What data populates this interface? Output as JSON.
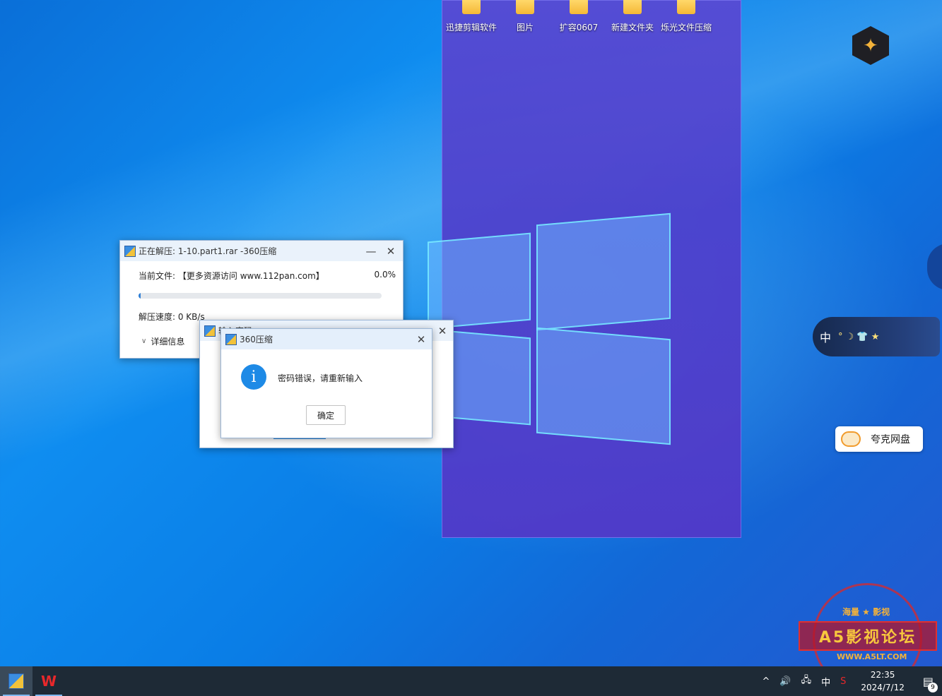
{
  "desktop": {
    "icons": [
      {
        "label": "迅捷剪辑软件"
      },
      {
        "label": "图片"
      },
      {
        "label": "扩容0607"
      },
      {
        "label": "新建文件夹"
      },
      {
        "label": "烁光文件压缩"
      }
    ]
  },
  "extract_window": {
    "title": "正在解压: 1-10.part1.rar -360压缩",
    "current_file_label": "当前文件:",
    "current_file_value": "【更多资源访问 www.112pan.com】",
    "percent": "0.0%",
    "progress_fraction": 0.01,
    "speed": "解压速度: 0 KB/s",
    "details_toggle": "详细信息"
  },
  "password_window": {
    "title": "输入密码"
  },
  "error_dialog": {
    "title": "360压缩",
    "message": "密码错误，请重新输入",
    "ok_label": "确定"
  },
  "widgets": {
    "ime_label": "中",
    "ime_symbols": "° ☽ 👕 ★",
    "quark_label": "夸克网盘"
  },
  "watermark": {
    "top_text": "海量 ★ 影视",
    "banner_text": "A5影视论坛",
    "url": "WWW.A5LT.COM"
  },
  "taskbar": {
    "wps_glyph": "W",
    "tray_chevron": "^",
    "tray_volume": "🔊",
    "tray_network": "🖧",
    "tray_ime": "中",
    "time": "22:35",
    "date": "2024/7/12",
    "notification_count": "9"
  }
}
